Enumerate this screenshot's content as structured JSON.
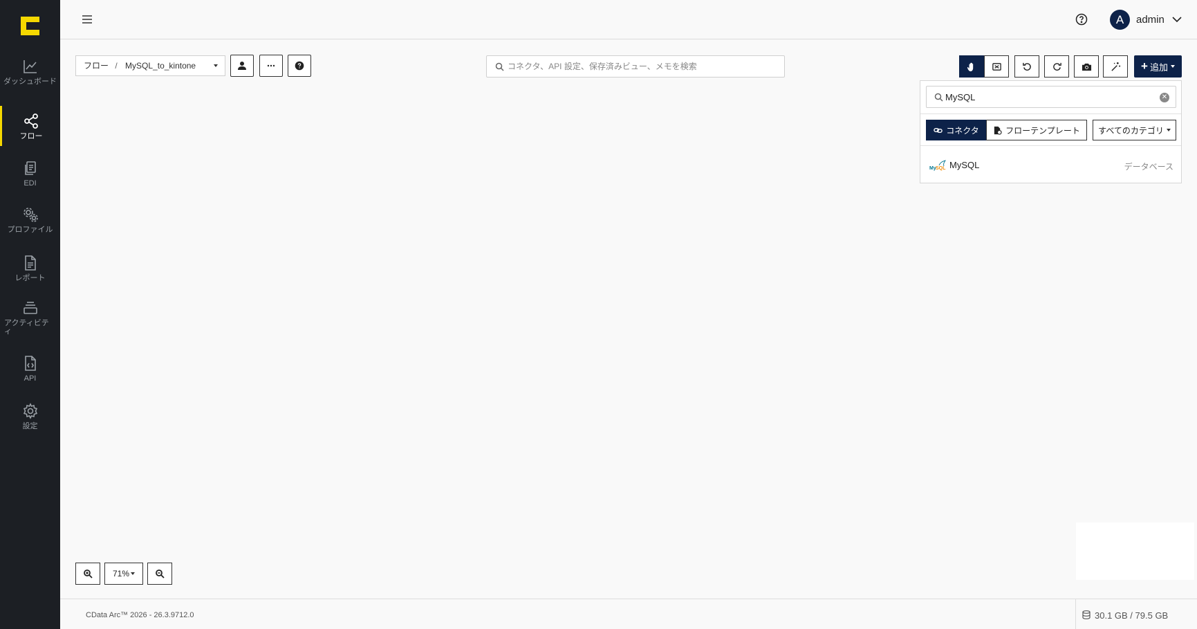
{
  "sidebar": {
    "items": [
      {
        "label": "ダッシュボード",
        "icon": "chart-line-icon"
      },
      {
        "label": "フロー",
        "icon": "share-nodes-icon",
        "active": true
      },
      {
        "label": "EDI",
        "icon": "documents-icon"
      },
      {
        "label": "プロファイル",
        "icon": "gears-icon"
      },
      {
        "label": "レポート",
        "icon": "file-text-icon"
      },
      {
        "label": "アクティビティ",
        "icon": "layers-icon"
      },
      {
        "label": "API",
        "icon": "file-code-icon"
      },
      {
        "label": "設定",
        "icon": "gear-icon"
      }
    ]
  },
  "header": {
    "avatar_letter": "A",
    "user_name": "admin"
  },
  "toolbar": {
    "breadcrumb_root": "フロー",
    "breadcrumb_sep": "/",
    "flow_name": "MySQL_to_kintone",
    "search_placeholder": "コネクタ、API 設定、保存済みビュー、メモを検索",
    "add_label": "追加"
  },
  "connector_panel": {
    "search_value": "MySQL",
    "tab_connector": "コネクタ",
    "tab_template": "フローテンプレート",
    "category_select": "すべてのカテゴリ",
    "results": [
      {
        "name": "MySQL",
        "category": "データベース"
      }
    ]
  },
  "zoom": {
    "level": "71%"
  },
  "footer": {
    "version": "CData Arc™ 2026 - 26.3.9712.0",
    "storage": "30.1 GB / 79.5 GB"
  },
  "colors": {
    "sidebar_bg": "#1c1f24",
    "accent_yellow": "#f5d800",
    "primary_navy": "#0d2249"
  }
}
